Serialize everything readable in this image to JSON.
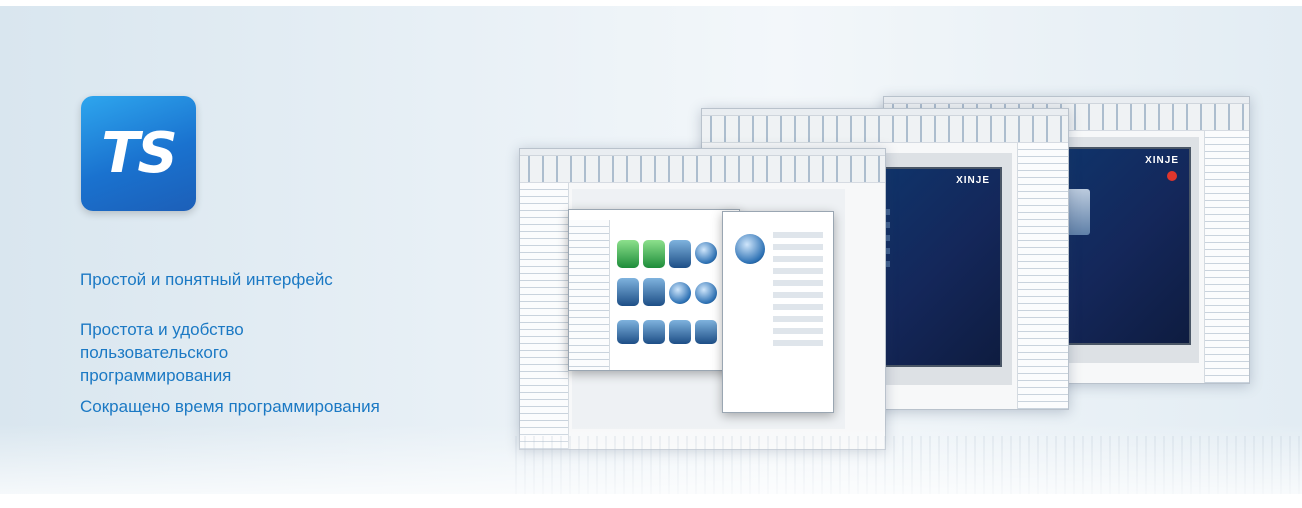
{
  "logo": {
    "text": "TS"
  },
  "features": [
    "Простой и понятный  интерфейс",
    "Простота и удобство пользовательского программирования",
    "Сокращено время программирования"
  ],
  "screens": {
    "hmi_brand": "XINJE"
  },
  "colors": {
    "accent_text": "#1b79c4",
    "logo_top": "#2ea6ee",
    "logo_bottom": "#1c5fb8",
    "background": "#e8f0f6"
  }
}
